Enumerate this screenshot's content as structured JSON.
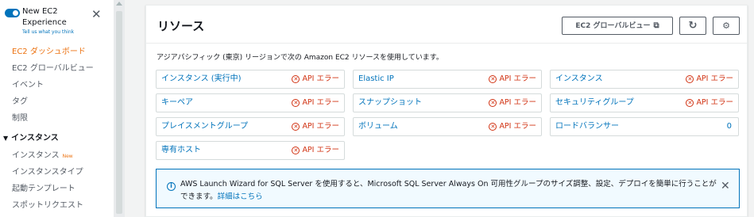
{
  "sidebar": {
    "toggle_title": "New EC2 Experience",
    "toggle_sub": "Tell us what you think",
    "close_glyph": "✕",
    "items": [
      {
        "label": "EC2 ダッシュボード"
      },
      {
        "label": "EC2 グローバルビュー"
      },
      {
        "label": "イベント"
      },
      {
        "label": "タグ"
      },
      {
        "label": "制限"
      }
    ],
    "section_title": "インスタンス",
    "section_items": [
      {
        "label": "インスタンス",
        "badge": "New"
      },
      {
        "label": "インスタンスタイプ"
      },
      {
        "label": "起動テンプレート"
      },
      {
        "label": "スポットリクエスト"
      }
    ]
  },
  "panel": {
    "title": "リソース",
    "global_view_label": "EC2 グローバルビュー",
    "external_icon": "⧉",
    "refresh_icon": "↻",
    "settings_icon": "⚙",
    "description": "アジアパシフィック (東京) リージョンで次の Amazon EC2 リソースを使用しています。",
    "error_text": "API エラー",
    "error_glyph": "✕",
    "resources": [
      {
        "label": "インスタンス (実行中)",
        "status": "error"
      },
      {
        "label": "Elastic IP",
        "status": "error"
      },
      {
        "label": "インスタンス",
        "status": "error"
      },
      {
        "label": "キーペア",
        "status": "error"
      },
      {
        "label": "スナップショット",
        "status": "error"
      },
      {
        "label": "セキュリティグループ",
        "status": "error"
      },
      {
        "label": "プレイスメントグループ",
        "status": "error"
      },
      {
        "label": "ボリューム",
        "status": "error"
      },
      {
        "label": "ロードバランサー",
        "value": "0"
      },
      {
        "label": "専有ホスト",
        "status": "error"
      }
    ]
  },
  "info": {
    "icon": "i",
    "text": "AWS Launch Wizard for SQL Server を使用すると、Microsoft SQL Server Always On 可用性グループのサイズ調整、設定、デプロイを簡単に行うことができます。",
    "link": "詳細はこちら",
    "close_glyph": "✕"
  },
  "colors": {
    "accent": "#0073bb",
    "active_nav": "#ec7211",
    "error": "#d13212"
  }
}
